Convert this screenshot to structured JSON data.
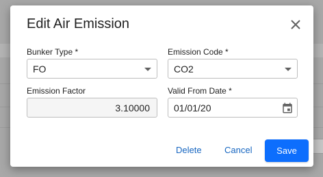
{
  "dialog": {
    "title": "Edit Air Emission"
  },
  "fields": {
    "bunker_type": {
      "label": "Bunker Type *",
      "value": "FO"
    },
    "emission_code": {
      "label": "Emission Code *",
      "value": "CO2"
    },
    "emission_factor": {
      "label": "Emission Factor",
      "value": "3.10000"
    },
    "valid_from_date": {
      "label": "Valid From Date *",
      "value": "01/01/20"
    }
  },
  "actions": {
    "delete_label": "Delete",
    "cancel_label": "Cancel",
    "save_label": "Save"
  },
  "icons": {
    "close": "close-icon",
    "dropdown": "chevron-down-icon",
    "calendar": "calendar-icon"
  },
  "colors": {
    "accent": "#0d6efd",
    "link": "#1565c0",
    "backdrop": "#a8a8a8"
  }
}
